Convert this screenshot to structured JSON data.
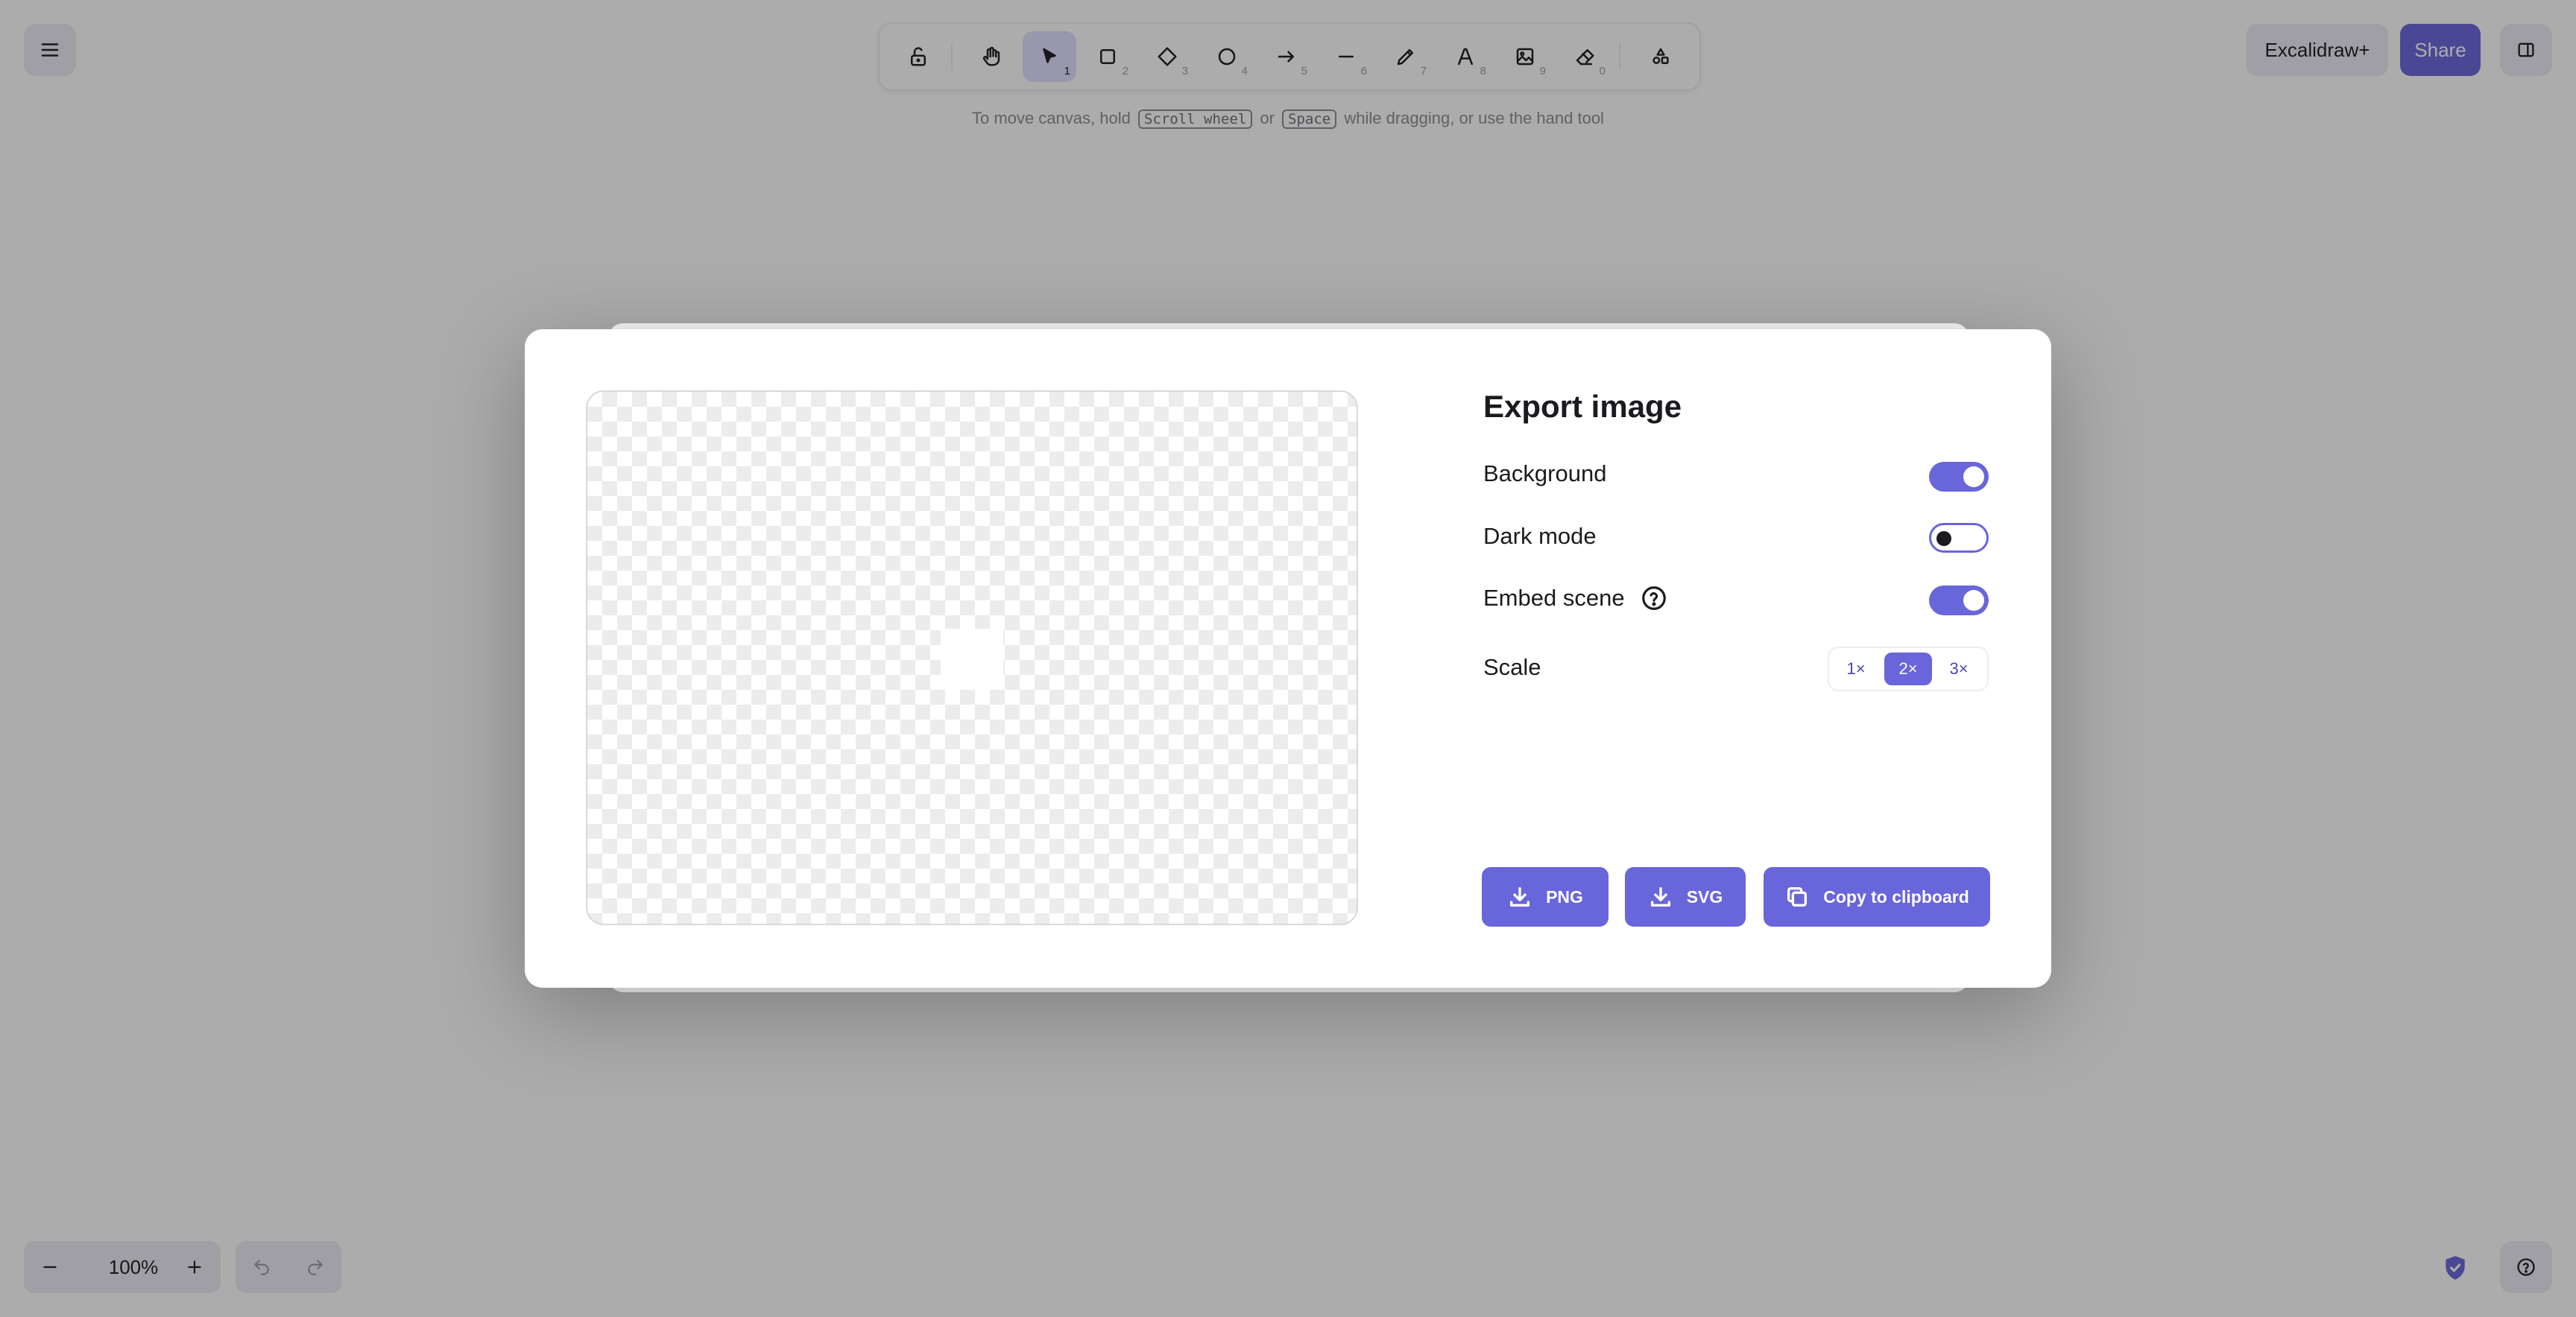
{
  "toolbar": {
    "tools": [
      {
        "name": "lock-tool",
        "key": ""
      },
      {
        "name": "hand-tool",
        "key": ""
      },
      {
        "name": "selection-tool",
        "key": "1"
      },
      {
        "name": "rectangle-tool",
        "key": "2"
      },
      {
        "name": "diamond-tool",
        "key": "3"
      },
      {
        "name": "ellipse-tool",
        "key": "4"
      },
      {
        "name": "arrow-tool",
        "key": "5"
      },
      {
        "name": "line-tool",
        "key": "6"
      },
      {
        "name": "draw-tool",
        "key": "7"
      },
      {
        "name": "text-tool",
        "key": "8"
      },
      {
        "name": "image-tool",
        "key": "9"
      },
      {
        "name": "eraser-tool",
        "key": "0"
      },
      {
        "name": "shapes-library-tool",
        "key": ""
      }
    ],
    "active_tool": "selection-tool"
  },
  "hint": {
    "before": "To move canvas, hold",
    "key1": "Scroll wheel",
    "or": "or",
    "key2": "Space",
    "after": "while dragging, or use the hand tool"
  },
  "header": {
    "plus_label": "Excalidraw+",
    "share_label": "Share"
  },
  "dialog": {
    "title": "Export image",
    "background_label": "Background",
    "background_on": true,
    "dark_mode_label": "Dark mode",
    "dark_mode_on": false,
    "embed_scene_label": "Embed scene",
    "embed_scene_on": true,
    "scale_label": "Scale",
    "scale_options": [
      "1×",
      "2×",
      "3×"
    ],
    "scale_selected": "2×",
    "png_label": "PNG",
    "svg_label": "SVG",
    "clipboard_label": "Copy to clipboard"
  },
  "footer": {
    "zoom_value": "100%"
  },
  "colors": {
    "accent": "#6965db",
    "accent_light": "#e0dfff",
    "island": "#ececf4",
    "overlay": "rgba(18,18,18,0.35)"
  }
}
